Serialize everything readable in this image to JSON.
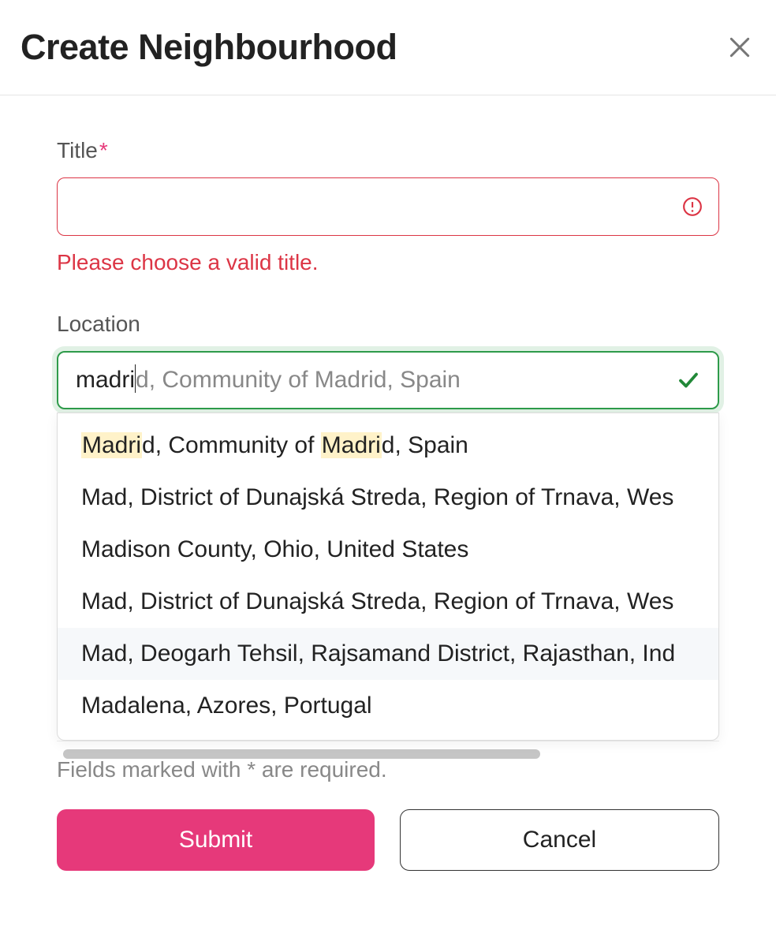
{
  "header": {
    "title": "Create Neighbourhood"
  },
  "form": {
    "title": {
      "label": "Title",
      "value": "",
      "error": "Please choose a valid title."
    },
    "location": {
      "label": "Location",
      "typed": "madri",
      "completion": "d, Community of Madrid, Spain"
    },
    "hint_prefix": "Fields marked with ",
    "hint_mark": "*",
    "hint_suffix": " are required."
  },
  "autocomplete": {
    "highlight": "Madri",
    "options": [
      {
        "text": "Madrid, Community of Madrid, Spain",
        "highlight": true,
        "hovered": false
      },
      {
        "text": "Mad, District of Dunajská Streda, Region of Trnava, Wes",
        "highlight": false,
        "hovered": false
      },
      {
        "text": "Madison County, Ohio, United States",
        "highlight": false,
        "hovered": false
      },
      {
        "text": "Mad, District of Dunajská Streda, Region of Trnava, Wes",
        "highlight": false,
        "hovered": false
      },
      {
        "text": "Mad, Deogarh Tehsil, Rajsamand District, Rajasthan, Ind",
        "highlight": false,
        "hovered": true
      },
      {
        "text": "Madalena, Azores, Portugal",
        "highlight": false,
        "hovered": false
      }
    ]
  },
  "buttons": {
    "submit": "Submit",
    "cancel": "Cancel"
  }
}
